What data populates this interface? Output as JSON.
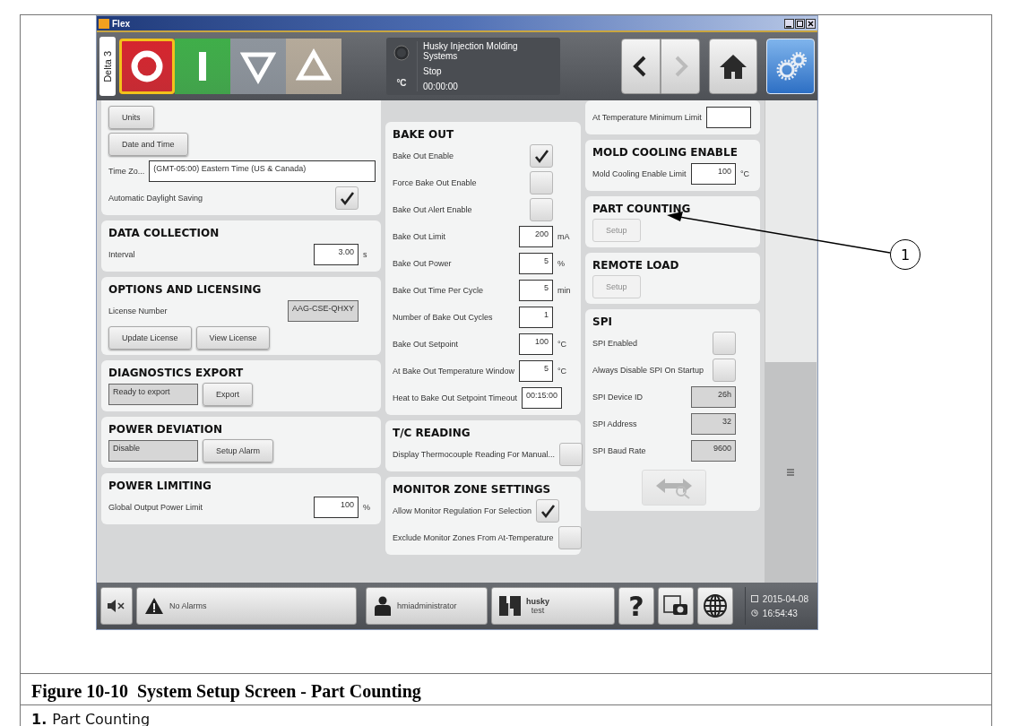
{
  "window": {
    "title": "Flex"
  },
  "toolbar": {
    "station": "Delta 3",
    "machine_buttons": [
      {
        "kind": "stop",
        "selected": true
      },
      {
        "kind": "start",
        "selected": false
      },
      {
        "kind": "down",
        "selected": false
      },
      {
        "kind": "up",
        "selected": false
      }
    ],
    "status": {
      "unit": "°C",
      "company": "Husky Injection Molding Systems",
      "state": "Stop",
      "time": "00:00:00"
    },
    "nav": [
      {
        "kind": "back",
        "disabled": false
      },
      {
        "kind": "forward",
        "disabled": true
      }
    ],
    "screens": [
      {
        "kind": "home",
        "selected": false
      },
      {
        "kind": "settings",
        "selected": true
      }
    ]
  },
  "columns": [
    [
      {
        "rows": [
          {
            "kind": "inline",
            "items": [
              {
                "kind": "button",
                "label": "Units",
                "disabled": false
              }
            ]
          },
          {
            "kind": "inline",
            "items": [
              {
                "kind": "button",
                "label": "Date and Time",
                "disabled": false
              }
            ]
          },
          {
            "kind": "field",
            "label": "Time Zo...",
            "value": "(GMT-05:00) Eastern Time (US & Canada)"
          },
          {
            "kind": "checkbox",
            "label": "Automatic Daylight Saving",
            "checked": true
          }
        ]
      },
      {
        "title": "DATA COLLECTION",
        "rows": [
          {
            "kind": "number",
            "label": "Interval",
            "value": "3.00",
            "unit": "s"
          }
        ]
      },
      {
        "title": "OPTIONS AND LICENSING",
        "rows": [
          {
            "kind": "readonly",
            "label": "License Number",
            "value": "AAG-CSE-QHXY"
          },
          {
            "kind": "inline",
            "items": [
              {
                "kind": "button",
                "label": "Update License",
                "disabled": false
              },
              {
                "kind": "button",
                "label": "View License",
                "disabled": false
              }
            ]
          }
        ]
      },
      {
        "title": "DIAGNOSTICS EXPORT",
        "rows": [
          {
            "kind": "inline",
            "items": [
              {
                "kind": "readonly",
                "value": "Ready to export"
              },
              {
                "kind": "button",
                "label": "Export",
                "disabled": false
              }
            ]
          }
        ]
      },
      {
        "title": "POWER DEVIATION",
        "rows": [
          {
            "kind": "inline",
            "items": [
              {
                "kind": "readonly",
                "value": "Disable"
              },
              {
                "kind": "button",
                "label": "Setup Alarm",
                "disabled": false
              }
            ]
          }
        ]
      },
      {
        "title": "POWER LIMITING",
        "rows": [
          {
            "kind": "number",
            "label": "Global Output Power Limit",
            "value": "100",
            "unit": "%"
          }
        ]
      }
    ],
    [
      {
        "title": "BAKE OUT",
        "rows": [
          {
            "kind": "checkbox",
            "label": "Bake Out Enable",
            "checked": true
          },
          {
            "kind": "checkbox",
            "label": "Force Bake Out Enable",
            "checked": false
          },
          {
            "kind": "checkbox",
            "label": "Bake Out Alert Enable",
            "checked": false
          },
          {
            "kind": "number",
            "label": "Bake Out Limit",
            "value": "200",
            "unit": "mA"
          },
          {
            "kind": "number",
            "label": "Bake Out Power",
            "value": "5",
            "unit": "%"
          },
          {
            "kind": "number",
            "label": "Bake Out Time Per Cycle",
            "value": "5",
            "unit": "min"
          },
          {
            "kind": "number",
            "label": "Number of Bake Out Cycles",
            "value": "1"
          },
          {
            "kind": "number",
            "label": "Bake Out Setpoint",
            "value": "100",
            "unit": "°C"
          },
          {
            "kind": "number",
            "label": "At Bake Out Temperature Window",
            "value": "5",
            "unit": "°C"
          },
          {
            "kind": "number",
            "label": "Heat to Bake Out Setpoint Timeout",
            "value": "00:15:00"
          }
        ]
      },
      {
        "title": "T/C READING",
        "rows": [
          {
            "kind": "checkbox",
            "label": "Display Thermocouple Reading For Manual...",
            "checked": false
          }
        ]
      },
      {
        "title": "MONITOR ZONE SETTINGS",
        "rows": [
          {
            "kind": "checkbox",
            "label": "Allow Monitor Regulation For Selection",
            "checked": true
          },
          {
            "kind": "checkbox",
            "label": "Exclude Monitor Zones From At-Temperature",
            "checked": false
          }
        ]
      }
    ],
    [
      {
        "rows": [
          {
            "kind": "number",
            "label": "At Temperature Minimum Limit"
          }
        ]
      },
      {
        "title": "MOLD COOLING ENABLE",
        "rows": [
          {
            "kind": "number",
            "label": "Mold Cooling Enable Limit",
            "value": "100",
            "unit": "°C"
          }
        ]
      },
      {
        "title": "PART COUNTING",
        "rows": [
          {
            "kind": "inline",
            "items": [
              {
                "kind": "button",
                "label": "Setup",
                "disabled": true
              }
            ]
          }
        ]
      },
      {
        "title": "REMOTE LOAD",
        "rows": [
          {
            "kind": "inline",
            "items": [
              {
                "kind": "button",
                "label": "Setup",
                "disabled": true
              }
            ]
          }
        ]
      },
      {
        "title": "SPI",
        "rows": [
          {
            "kind": "checkbox",
            "label": "SPI Enabled",
            "checked": false
          },
          {
            "kind": "checkbox",
            "label": "Always Disable SPI On Startup",
            "checked": false
          },
          {
            "kind": "readonly",
            "label": "SPI Device ID",
            "value": "26h"
          },
          {
            "kind": "readonly",
            "label": "SPI Address",
            "value": "32"
          },
          {
            "kind": "readonly",
            "label": "SPI Baud Rate",
            "value": "9600"
          },
          {
            "kind": "icon_button",
            "disabled": true
          }
        ]
      }
    ]
  ],
  "footer": {
    "alarm": "No Alarms",
    "user": "hmiadministrator",
    "brand": {
      "name": "husky",
      "sub": "test"
    },
    "help": "?",
    "date": "2015-04-08",
    "time": "16:54:43"
  },
  "caption": {
    "title": "Figure 10-10  System Setup Screen - Part Counting",
    "legend": [
      {
        "number": "1.",
        "text": "Part Counting"
      }
    ]
  },
  "callouts": [
    {
      "number": "1"
    }
  ]
}
